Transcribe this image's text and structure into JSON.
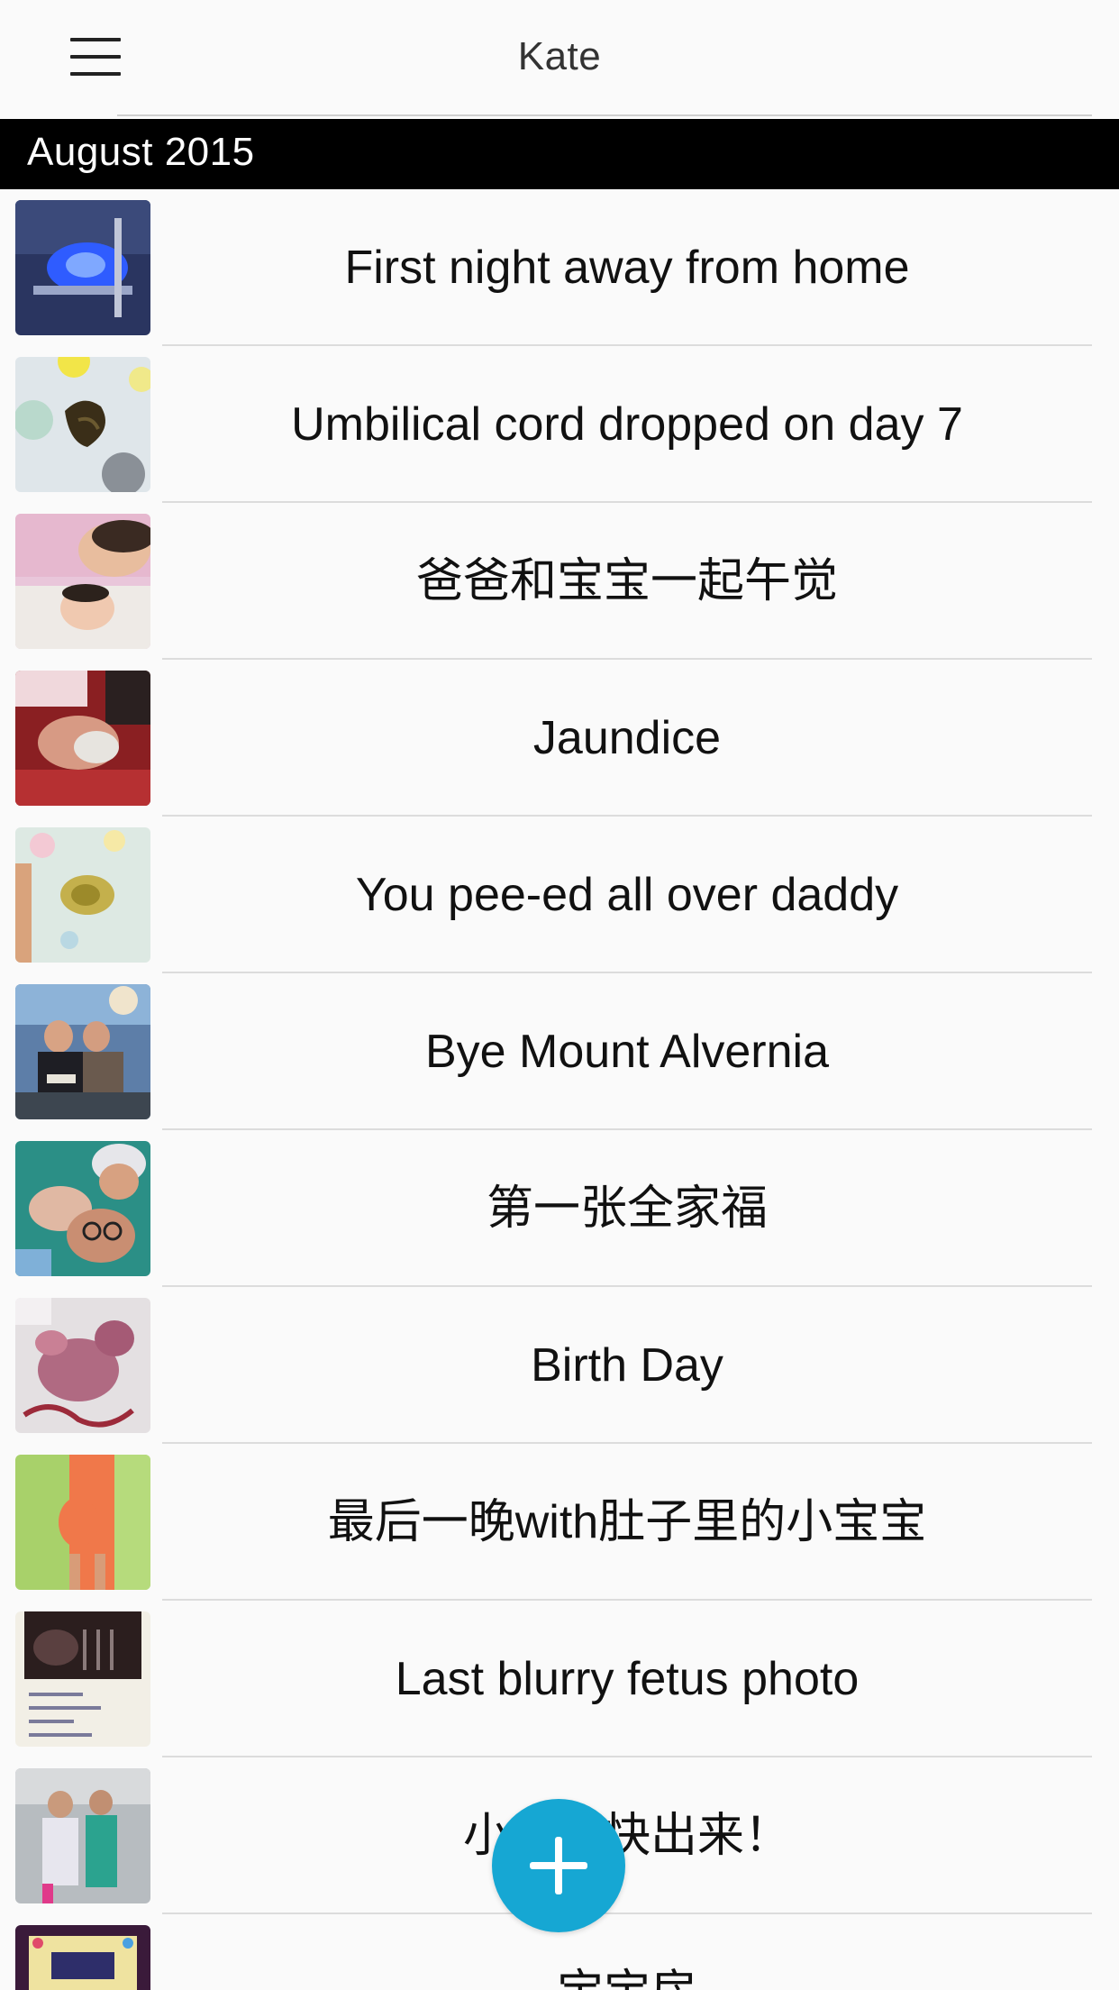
{
  "header": {
    "title": "Kate",
    "menu_icon": "hamburger-menu-icon"
  },
  "section": {
    "label": "August 2015"
  },
  "entries": [
    {
      "label": "First night away from home"
    },
    {
      "label": "Umbilical cord dropped on day 7"
    },
    {
      "label": "爸爸和宝宝一起午觉"
    },
    {
      "label": "Jaundice"
    },
    {
      "label": "You pee-ed all over daddy"
    },
    {
      "label": "Bye Mount Alvernia"
    },
    {
      "label": "第一张全家福"
    },
    {
      "label": "Birth Day"
    },
    {
      "label": "最后一晚with肚子里的小宝宝"
    },
    {
      "label": "Last blurry fetus photo"
    },
    {
      "label": "小宝宝快出来！"
    },
    {
      "label": "宝宝房"
    }
  ],
  "fab": {
    "icon": "plus-icon",
    "color": "#16a7d3"
  }
}
